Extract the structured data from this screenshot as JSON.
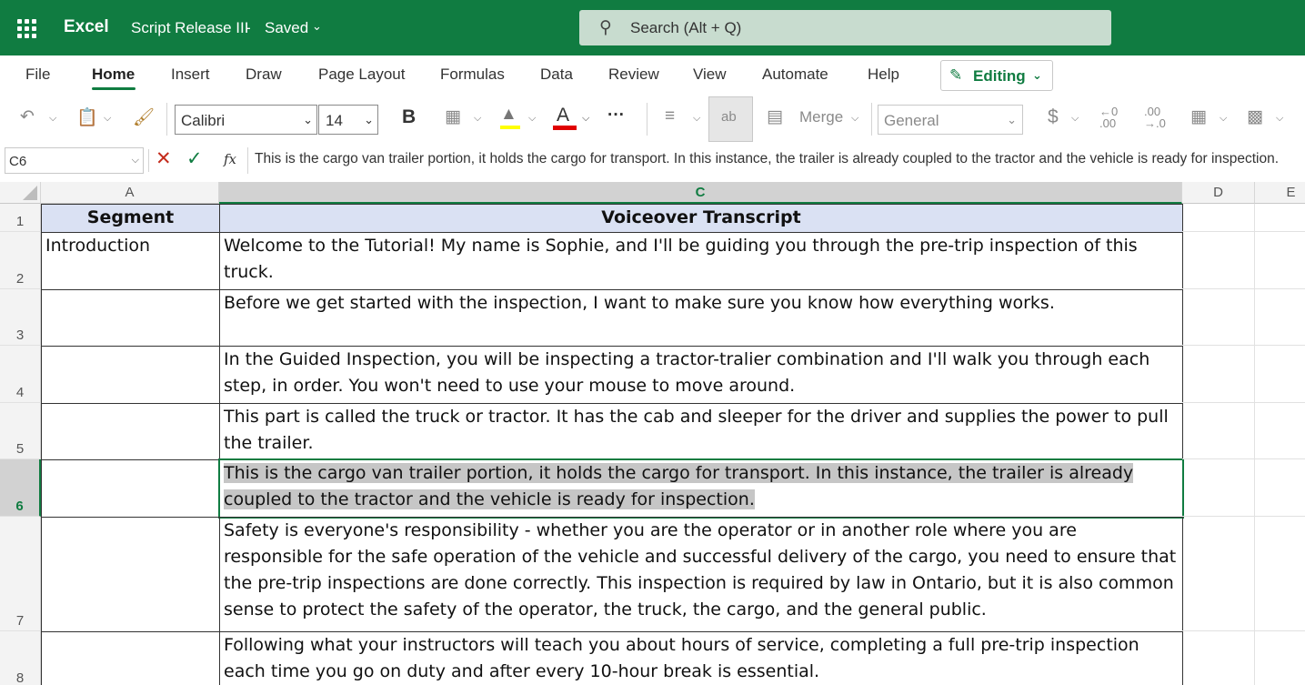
{
  "titlebar": {
    "app_name": "Excel",
    "doc_title": "Script Release III",
    "separator": "-",
    "status": "Saved",
    "search_placeholder": "Search (Alt + Q)"
  },
  "menu": {
    "tabs": [
      "File",
      "Home",
      "Insert",
      "Draw",
      "Page Layout",
      "Formulas",
      "Data",
      "Review",
      "View",
      "Automate",
      "Help"
    ],
    "active_tab": "Home",
    "mode_button": "Editing"
  },
  "ribbon": {
    "font_name": "Calibri",
    "font_size": "14",
    "bold_label": "B",
    "font_color_label": "A",
    "more_label": "···",
    "merge_label": "Merge",
    "number_format": "General",
    "currency_label": "$",
    "accent_color": "#107c41",
    "font_color": "#e00000",
    "highlight_color": "#ffff00"
  },
  "formula_bar": {
    "name_box": "C6",
    "fx_label": "fx",
    "formula": "This is the cargo van trailer portion, it holds the cargo for transport. In this instance, the trailer is already coupled to the tractor and the vehicle is ready for inspection."
  },
  "sheet": {
    "columns": [
      "A",
      "C",
      "D",
      "E"
    ],
    "selected_column": "C",
    "selected_row": "6",
    "rows": [
      {
        "num": "1",
        "a": "Segment",
        "c": "Voiceover Transcript"
      },
      {
        "num": "2",
        "a": "Introduction",
        "c": "Welcome to the Tutorial!  My name is  Sophie,  and I'll be guiding you through the pre-trip inspection of this truck."
      },
      {
        "num": "3",
        "a": "",
        "c": "Before we get started with the inspection,  I want to make sure you know how everything works."
      },
      {
        "num": "4",
        "a": "",
        "c": "In the Guided Inspection, you will be inspecting a tractor-tralier combination and  I'll walk you through each step,  in order.  You won't need to use your mouse to move around."
      },
      {
        "num": "5",
        "a": "",
        "c": "This part is called the truck or tractor. It has the cab and sleeper for the driver and supplies the power to pull the trailer."
      },
      {
        "num": "6",
        "a": "",
        "c": "This is the cargo van trailer portion, it holds the cargo for transport. In this instance, the trailer is already coupled to the tractor and the vehicle is ready for inspection."
      },
      {
        "num": "7",
        "a": "",
        "c": "Safety is everyone's responsibility - whether you are the operator or in another role where you are responsible for the safe operation of the vehicle and successful delivery of the cargo, you need to ensure that the pre-trip inspections are done correctly. This inspection is required by law in Ontario, but it is also common sense to protect the safety of the operator, the truck, the cargo, and the general public."
      },
      {
        "num": "8",
        "a": "",
        "c": "Following what your instructors will teach you about hours of service, completing a full pre-trip inspection each time you go on duty and after every 10-hour break is essential."
      }
    ]
  }
}
